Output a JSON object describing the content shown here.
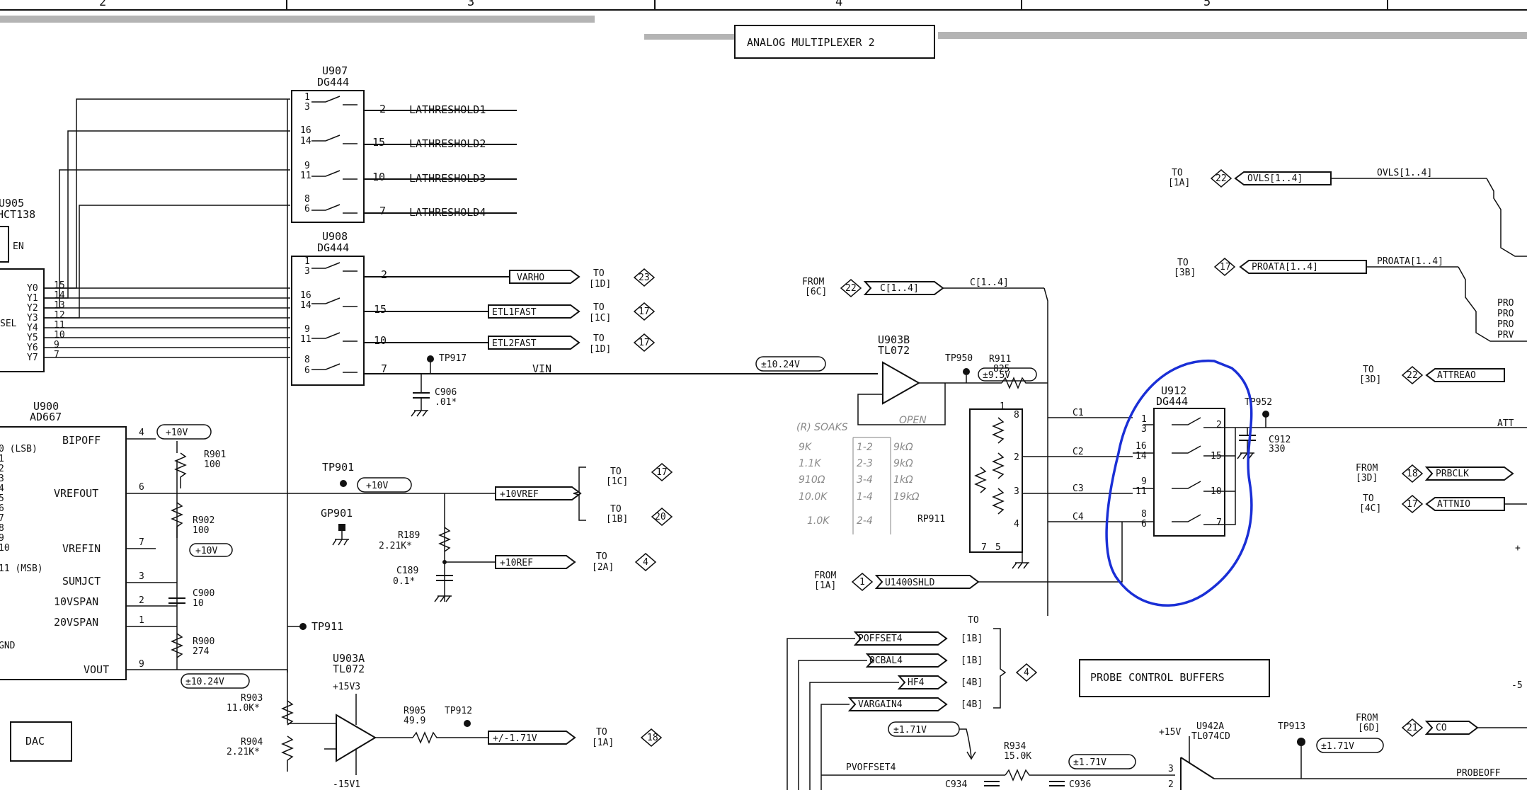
{
  "header": {
    "column_numbers": [
      "2",
      "3",
      "4",
      "5"
    ],
    "sheet_title": "ANALOG MULTIPLEXER 2"
  },
  "blocks": {
    "dac_label": "DAC",
    "probe_control_buffers": "PROBE CONTROL BUFFERS"
  },
  "components": {
    "u907": {
      "ref": "U907",
      "part": "DG444"
    },
    "u908": {
      "ref": "U908",
      "part": "DG444"
    },
    "u905": {
      "ref": "U905",
      "part": "HCT138"
    },
    "u900": {
      "ref": "U900",
      "part": "AD667"
    },
    "u903b": {
      "ref": "U903B",
      "part": "TL072"
    },
    "u903a": {
      "ref": "U903A",
      "part": "TL072"
    },
    "u912": {
      "ref": "U912",
      "part": "DG444"
    },
    "u942a": {
      "ref": "U942A",
      "part": "TL074CD"
    },
    "r901": {
      "ref": "R901",
      "value": "100"
    },
    "r902": {
      "ref": "R902",
      "value": "100"
    },
    "r900": {
      "ref": "R900",
      "value": "274"
    },
    "r903": {
      "ref": "R903",
      "value": "11.0K*"
    },
    "r904": {
      "ref": "R904",
      "value": "2.21K*"
    },
    "r905": {
      "ref": "R905",
      "value": "49.9"
    },
    "r189": {
      "ref": "R189",
      "value": "2.21K*"
    },
    "r911": {
      "ref": "R911",
      "value": "825"
    },
    "r934": {
      "ref": "R934",
      "value": "15.0K"
    },
    "c906": {
      "ref": "C906",
      "value": ".01*"
    },
    "c900": {
      "ref": "C900",
      "value": "10"
    },
    "c189": {
      "ref": "C189",
      "value": "0.1*"
    },
    "c912": {
      "ref": "C912",
      "value": "330"
    },
    "c934": {
      "ref": "C934"
    },
    "c936": {
      "ref": "C936"
    },
    "rp911": {
      "ref": "RP911"
    }
  },
  "test_points": [
    "TP917",
    "TP901",
    "GP901",
    "TP911",
    "TP912",
    "TP950",
    "TP952",
    "TP913"
  ],
  "u907_outputs": [
    {
      "pins_in": [
        "1",
        "3"
      ],
      "pin_out": "2",
      "signal": "LATHRESHOLD1"
    },
    {
      "pins_in": [
        "16",
        "14"
      ],
      "pin_out": "15",
      "signal": "LATHRESHOLD2"
    },
    {
      "pins_in": [
        "9",
        "11"
      ],
      "pin_out": "10",
      "signal": "LATHRESHOLD3"
    },
    {
      "pins_in": [
        "8",
        "6"
      ],
      "pin_out": "7",
      "signal": "LATHRESHOLD4"
    }
  ],
  "u908_outputs": [
    {
      "pins_in": [
        "1",
        "3"
      ],
      "pin_out": "2",
      "signal": "VARHO",
      "to": "TO\n[1D]",
      "ref": "23"
    },
    {
      "pins_in": [
        "16",
        "14"
      ],
      "pin_out": "15",
      "signal": "ETL1FAST",
      "to": "TO\n[1C]",
      "ref": "17"
    },
    {
      "pins_in": [
        "9",
        "11"
      ],
      "pin_out": "10",
      "signal": "ETL2FAST",
      "to": "TO\n[1D]",
      "ref": "17"
    },
    {
      "pins_in": [
        "8",
        "6"
      ],
      "pin_out": "7",
      "signal": "VIN"
    }
  ],
  "u905_pins": [
    "Y0",
    "Y1",
    "Y2",
    "Y3",
    "Y4",
    "Y5",
    "Y6",
    "Y7"
  ],
  "u905_pin_nums": [
    "15",
    "14",
    "13",
    "12",
    "11",
    "10",
    "9",
    "7"
  ],
  "u905_labels": {
    "en": "EN",
    "sel": "SEL"
  },
  "u900_pins_left": [
    "0 (LSB)",
    "1",
    "2",
    "3",
    "4",
    "5",
    "6",
    "7",
    "8",
    "9",
    "10",
    "11 (MSB)"
  ],
  "u900_pins_right": [
    {
      "name": "BIPOFF",
      "num": "4"
    },
    {
      "name": "VREFOUT",
      "num": "6"
    },
    {
      "name": "VREFIN",
      "num": "7"
    },
    {
      "name": "SUMJCT",
      "num": "3"
    },
    {
      "name": "10VSPAN",
      "num": "2"
    },
    {
      "name": "20VSPAN",
      "num": "1"
    },
    {
      "name": "VOUT",
      "num": "9"
    }
  ],
  "u900_gnd": "GND",
  "voltage_tags": {
    "plus10v_a": "+10V",
    "plus10v_b": "+10V",
    "plus10v_c": "+10V",
    "pm10_24v_a": "±10.24V",
    "pm10_24v_b": "±10.24V",
    "pm9_5v": "±9.5V",
    "pm1_71v_a": "±1.71V",
    "pm1_71v_b": "±1.71V",
    "pm1_71v_c": "±1.71V",
    "plus15v3": "+15V3",
    "minus15v1": "-15V1",
    "plus15v": "+15V"
  },
  "offpage_left": [
    {
      "signal": "+10VREF",
      "to": "TO\n[1C]",
      "ref": "17"
    },
    {
      "signal": "+10VREF",
      "to": "TO\n[1B]",
      "ref": "20"
    },
    {
      "signal": "+10REF",
      "to": "TO\n[2A]",
      "ref": "4"
    },
    {
      "signal": "+/-1.71V",
      "to": "TO\n[1A]",
      "ref": "18"
    }
  ],
  "right_side": {
    "ovls": {
      "to": "TO\n[1A]",
      "ref": "22",
      "tag": "OVLS[1..4]",
      "bus": "OVLS[1..4]"
    },
    "proata": {
      "to": "TO\n[3B]",
      "ref": "17",
      "tag": "PROATA[1..4]",
      "bus": "PROATA[1..4]"
    },
    "c_in": {
      "from": "FROM\n[6C]",
      "ref": "22",
      "tag": "C[1..4]",
      "bus": "C[1..4]"
    },
    "c_lines": [
      "C1",
      "C2",
      "C3",
      "C4"
    ],
    "attreao": {
      "to": "TO\n[3D]",
      "ref": "22",
      "tag": "ATTREAO"
    },
    "prbclk": {
      "from": "FROM\n[3D]",
      "ref": "18",
      "tag": "PRBCLK"
    },
    "attnio": {
      "to": "TO\n[4C]",
      "ref": "17",
      "tag": "ATTNIO"
    },
    "u1400shld": {
      "from": "FROM\n[1A]",
      "ref": "1",
      "tag": "U1400SHLD"
    },
    "probe_buffers_to": "TO",
    "probe_outputs": [
      {
        "tag": "POFFSET4",
        "dest": "[1B]"
      },
      {
        "tag": "OCBAL4",
        "dest": "[1B]"
      },
      {
        "tag": "HF4",
        "dest": "[4B]"
      },
      {
        "tag": "VARGAIN4",
        "dest": "[4B]"
      }
    ],
    "probe_buffers_ref": "4",
    "co": {
      "from": "FROM\n[6D]",
      "ref": "21",
      "tag": "CO"
    },
    "pvoffset": "PVOFFSET4",
    "probeoff": "PROBEOFF",
    "att_trunc": "ATT",
    "minus5_trunc": "-5",
    "pro_lines": [
      "PRO",
      "PRO",
      "PRO",
      "PRV"
    ]
  },
  "handwritten_notes": {
    "open": "OPEN",
    "table_title": "(R) SOAKS",
    "rows": [
      {
        "left": "9K",
        "mid": "1-2",
        "right": "9kΩ"
      },
      {
        "left": "1.1K",
        "mid": "2-3",
        "right": "9kΩ"
      },
      {
        "left": "910Ω",
        "mid": "3-4",
        "right": "1kΩ"
      },
      {
        "left": "10.0K",
        "mid": "1-4",
        "right": "19kΩ"
      },
      {
        "left": "1.0K",
        "mid": "2-4",
        "right": ""
      }
    ]
  },
  "highlight": {
    "color": "#1a2fd6",
    "around": "U912"
  }
}
